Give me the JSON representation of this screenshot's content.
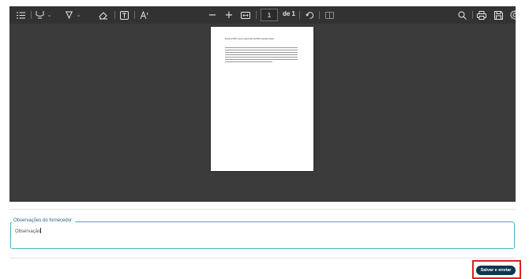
{
  "toolbar": {
    "icons": [
      "contents-icon",
      "highlight-icon",
      "draw-icon",
      "erase-icon",
      "text-box-icon",
      "read-aloud-icon",
      "zoom-out-icon",
      "zoom-in-icon",
      "fit-page-icon",
      "rotate-icon",
      "page-view-icon",
      "search-icon",
      "print-icon",
      "save-icon",
      "settings-icon"
    ],
    "zoom_out": "−",
    "zoom_in": "+",
    "page_current": "1",
    "page_of": "de 1"
  },
  "document": {
    "title": "Dummy PDF Lorem para teste de PDF (sample teste)"
  },
  "observations": {
    "legend": "Observações do fornecedor",
    "value": "Observação"
  },
  "actions": {
    "save_label": "Salvar e enviar"
  },
  "colors": {
    "accent": "#3fb4c0",
    "button": "#0f3550",
    "highlight": "#e11e1e"
  }
}
